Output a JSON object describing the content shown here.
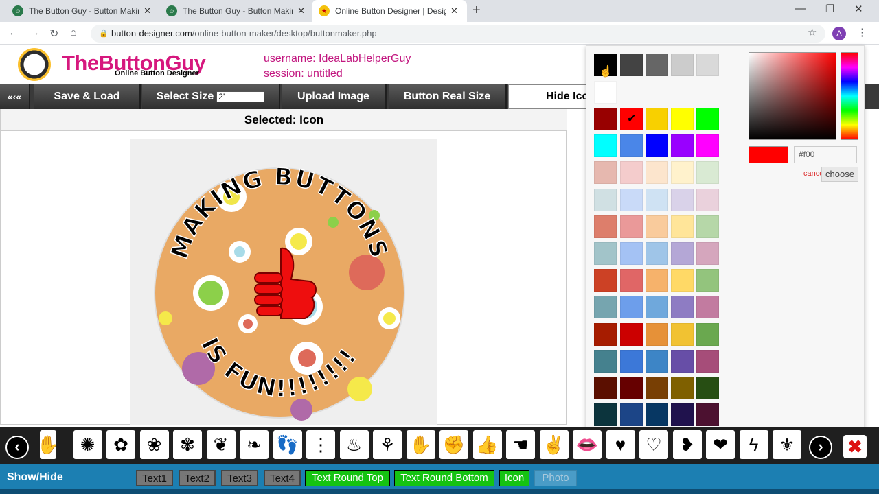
{
  "browser": {
    "tabs": [
      {
        "title": "The Button Guy - Button Making"
      },
      {
        "title": "The Button Guy - Button Making"
      },
      {
        "title": "Online Button Designer | Design"
      }
    ],
    "new_tab": "+",
    "window": {
      "minimize": "—",
      "restore": "❐",
      "close": "✕"
    },
    "url_host": "button-designer.com",
    "url_path": "/online-button-maker/desktop/buttonmaker.php",
    "profile_letter": "A"
  },
  "header": {
    "brand": "TheButtonGuy",
    "brand_sub": "Online Button Designer",
    "username": "username: IdeaLabHelperGuy",
    "session": "session: untitled"
  },
  "menu": {
    "collapse": "«‹«",
    "save_load": "Save & Load",
    "select_size": "Select Size",
    "size_value": "2'",
    "upload_image": "Upload Image",
    "real_size": "Button Real Size",
    "hide": "Hide Ico"
  },
  "workarea": {
    "selected": "Selected: Icon",
    "button_text_top": "MAKING BUTTONS",
    "button_text_bottom": "IS FUN!!!!!!!!"
  },
  "colorpicker": {
    "top_colors": [
      "#000000",
      "#434343",
      "#666666",
      "#cccccc",
      "#d9d9d9",
      "#ffffff"
    ],
    "rows": [
      [
        "#980000",
        "#ff0000",
        "#f8d000",
        "#ffff00",
        "#00ff00"
      ],
      [
        "#00ffff",
        "#4a86e8",
        "#0000ff",
        "#9900ff",
        "#ff00ff"
      ],
      [
        "#e6b8af",
        "#f4cccc",
        "#fce5cd",
        "#fff2cc",
        "#d9ead3"
      ],
      [
        "#d0e0e3",
        "#c9daf8",
        "#cfe2f3",
        "#d9d2e9",
        "#ead1dc"
      ],
      [
        "#dd7e6b",
        "#ea9999",
        "#f9cb9c",
        "#ffe599",
        "#b6d7a8"
      ],
      [
        "#a2c4c9",
        "#a4c2f4",
        "#9fc5e8",
        "#b4a7d6",
        "#d5a6bd"
      ],
      [
        "#cc4125",
        "#e06666",
        "#f6b26b",
        "#ffd966",
        "#93c47d"
      ],
      [
        "#76a5af",
        "#6d9eeb",
        "#6fa8dc",
        "#8e7cc3",
        "#c27ba0"
      ],
      [
        "#a61c00",
        "#cc0000",
        "#e69138",
        "#f1c232",
        "#6aa84f"
      ],
      [
        "#45818e",
        "#3c78d8",
        "#3d85c6",
        "#674ea7",
        "#a64d79"
      ],
      [
        "#5b0f00",
        "#660000",
        "#783f04",
        "#7f6000",
        "#274e13"
      ],
      [
        "#0c343d",
        "#1c4587",
        "#073763",
        "#20124d",
        "#4c1130"
      ]
    ],
    "selected_color": "#ff0000",
    "hex_value": "#f00",
    "cancel": "cancel",
    "choose": "choose"
  },
  "icons": {
    "prev": "‹",
    "next": "›",
    "close": "✖",
    "items": [
      {
        "name": "hand-partial-icon",
        "glyph": "✋"
      },
      {
        "name": "sunflower-icon",
        "glyph": "✺"
      },
      {
        "name": "flower-outline-icon",
        "glyph": "✿"
      },
      {
        "name": "flower-solid-icon",
        "glyph": "❀"
      },
      {
        "name": "flower-bunch-icon",
        "glyph": "✾"
      },
      {
        "name": "branch-icon",
        "glyph": "❦"
      },
      {
        "name": "leaf-icon",
        "glyph": "❧"
      },
      {
        "name": "footprints-icon",
        "glyph": "👣"
      },
      {
        "name": "foot-icon",
        "glyph": "⋮"
      },
      {
        "name": "flame-icon",
        "glyph": "♨"
      },
      {
        "name": "grass-icon",
        "glyph": "⚘"
      },
      {
        "name": "hand-icon",
        "glyph": "✋"
      },
      {
        "name": "fist-icon",
        "glyph": "✊"
      },
      {
        "name": "thumbs-up-icon",
        "glyph": "👍"
      },
      {
        "name": "pointing-hand-icon",
        "glyph": "☚"
      },
      {
        "name": "peace-icon",
        "glyph": "✌"
      },
      {
        "name": "lips-icon",
        "glyph": "👄"
      },
      {
        "name": "heart-solid-icon",
        "glyph": "♥"
      },
      {
        "name": "heart-outline-icon",
        "glyph": "♡"
      },
      {
        "name": "broken-heart-icon",
        "glyph": "❥"
      },
      {
        "name": "heart-ornate-icon",
        "glyph": "❤"
      },
      {
        "name": "lightning-icon",
        "glyph": "ϟ"
      },
      {
        "name": "fleur-de-lis-icon",
        "glyph": "⚜"
      }
    ]
  },
  "bottom": {
    "show_hide": "Show/Hide",
    "text1": "Text1",
    "text2": "Text2",
    "text3": "Text3",
    "text4": "Text4",
    "round_top": "Text Round Top",
    "round_bottom": "Text Round Bottom",
    "icon": "Icon",
    "photo": "Photo"
  }
}
